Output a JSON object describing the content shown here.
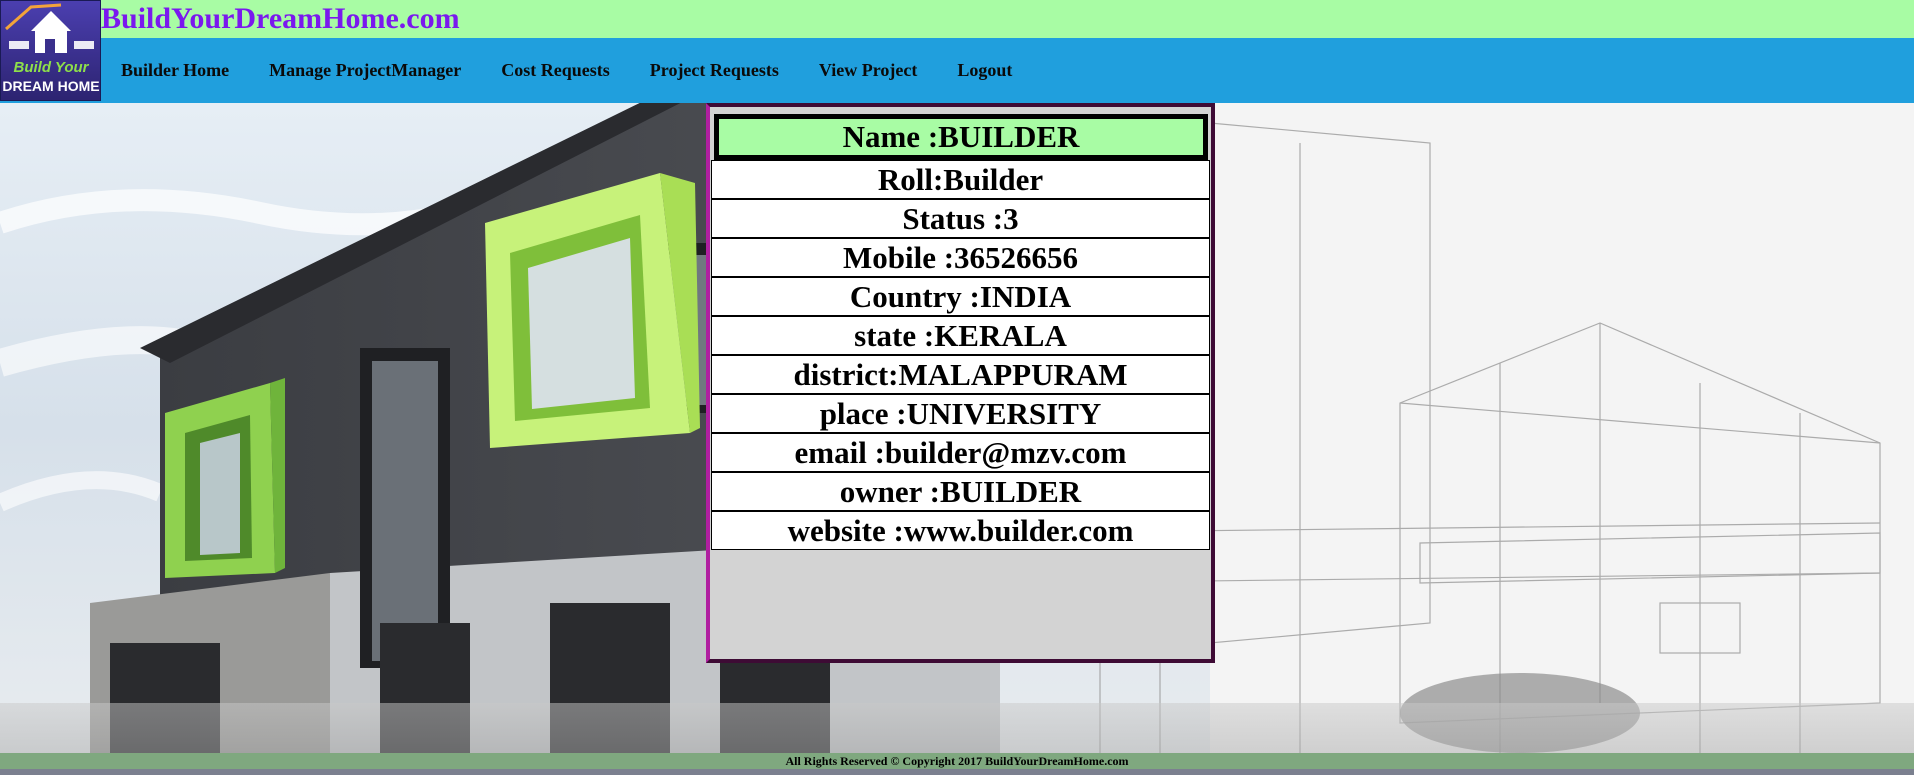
{
  "site": {
    "title": "BuildYourDreamHome.com",
    "logo_text_line1": "Build Your",
    "logo_text_line2": "DREAM HOME"
  },
  "nav": {
    "items": [
      {
        "label": "Builder Home"
      },
      {
        "label": "Manage ProjectManager"
      },
      {
        "label": "Cost Requests"
      },
      {
        "label": "Project Requests"
      },
      {
        "label": "View Project"
      },
      {
        "label": "Logout"
      }
    ]
  },
  "profile": {
    "name": "Name :BUILDER",
    "rows": [
      "Roll:Builder",
      "Status :3",
      "Mobile :36526656",
      "Country :INDIA",
      "state :KERALA",
      "district:MALAPPURAM",
      "place :UNIVERSITY",
      "email :builder@mzv.com",
      "owner :BUILDER",
      "website :www.builder.com"
    ]
  },
  "footer": {
    "text": "All Rights Reserved © Copyright 2017 BuildYourDreamHome.com"
  },
  "colors": {
    "top_bar": "#a8fca4",
    "nav_bar": "#209fdd",
    "title": "#7a18ee",
    "name_row": "#a8fca4",
    "footer": "#7fa87f"
  }
}
